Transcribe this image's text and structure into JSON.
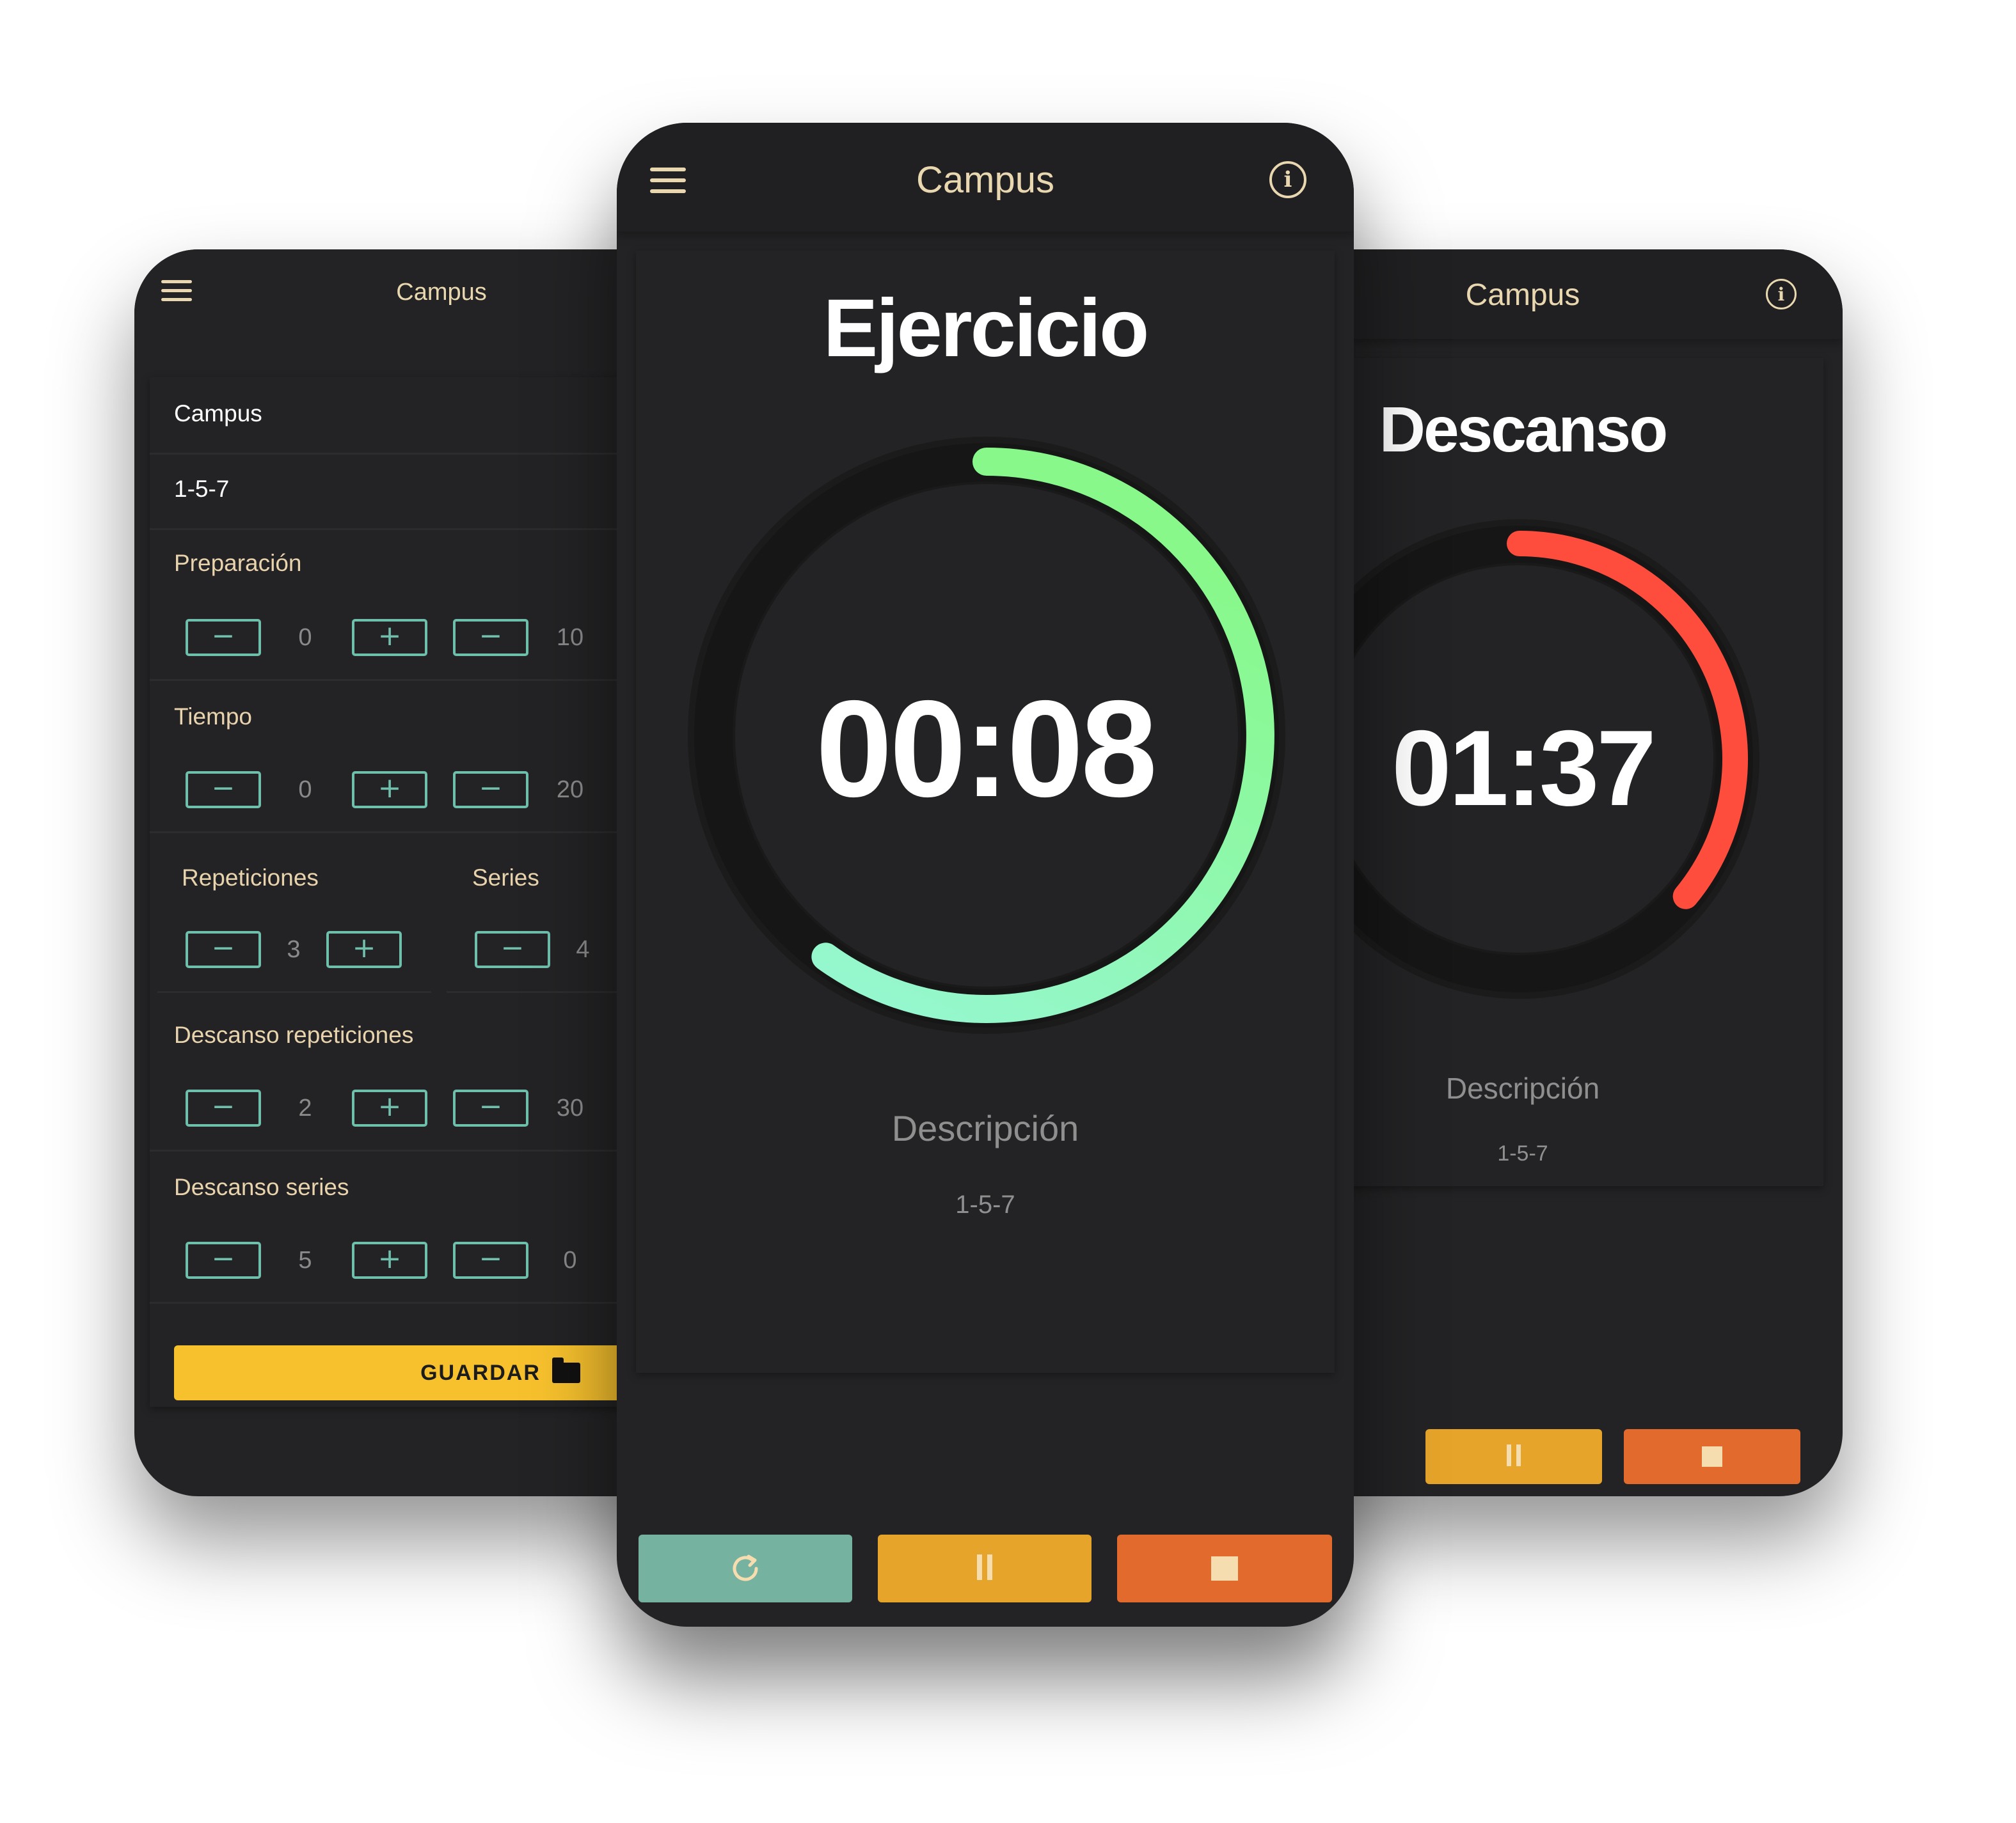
{
  "colors": {
    "background": "#ffffff",
    "phone_bg": "#232325",
    "header_text": "#e9d7b0",
    "stepper_border": "#6fbfad",
    "save_button": "#f7c12d",
    "exercise_arc_start": "#96f7d2",
    "exercise_arc_end": "#88f88a",
    "rest_arc": "#ff4d3d",
    "restart_button": "#76b2a0",
    "pause_button": "#e6a42a",
    "stop_button": "#e26a2c"
  },
  "left_screen": {
    "app_title": "Campus",
    "nav_rows": [
      {
        "label": "Campus",
        "icon": "chevron-right-icon"
      },
      {
        "label": "1-5-7",
        "icon": "chevron-right-icon"
      }
    ],
    "preparacion": {
      "label": "Preparación",
      "value_a": "0",
      "value_b": "10"
    },
    "tiempo": {
      "label": "Tiempo",
      "value_a": "0",
      "value_b": "20"
    },
    "repeticiones": {
      "label": "Repeticiones",
      "value": "3"
    },
    "series": {
      "label": "Series",
      "value": "4"
    },
    "descanso_repeticiones": {
      "label": "Descanso repeticiones",
      "value_a": "2",
      "value_b": "30"
    },
    "descanso_series": {
      "label": "Descanso series",
      "value_a": "5",
      "value_b": "0"
    },
    "save_button": {
      "label": "GUARDAR",
      "icon": "folder-icon"
    },
    "minus_symbol": "−",
    "plus_symbol": "+"
  },
  "center_screen": {
    "app_title": "Campus",
    "phase": "Ejercicio",
    "timer": "00:08",
    "progress": 0.6,
    "description_label": "Descripción",
    "description_value": "1-5-7",
    "buttons": {
      "restart": "restart-icon",
      "pause": "pause-icon",
      "stop": "stop-icon"
    }
  },
  "right_screen": {
    "app_title": "Campus",
    "phase": "Descanso",
    "timer": "01:37",
    "progress": 0.36,
    "description_label": "Descripción",
    "description_value": "1-5-7"
  }
}
